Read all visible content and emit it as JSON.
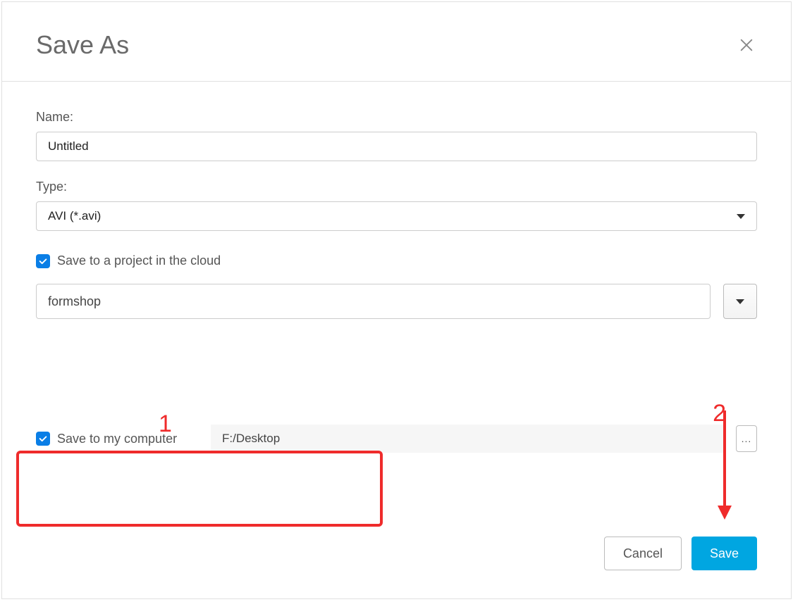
{
  "dialog": {
    "title": "Save As",
    "name_label": "Name:",
    "name_value": "Untitled",
    "type_label": "Type:",
    "type_value": "AVI (*.avi)",
    "cloud_check_label": "Save to a project in the cloud",
    "cloud_project": "formshop",
    "computer_check_label": "Save to my computer",
    "path_value": "F:/Desktop",
    "browse_label": "...",
    "cancel_label": "Cancel",
    "save_label": "Save"
  },
  "annotations": {
    "label1": "1",
    "label2": "2"
  }
}
